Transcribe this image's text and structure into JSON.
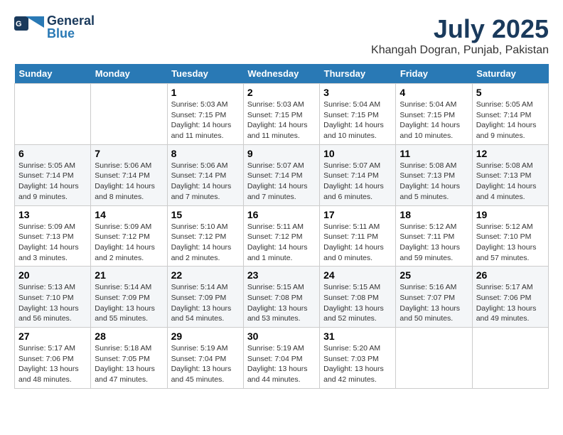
{
  "header": {
    "logo_line1": "General",
    "logo_line2": "Blue",
    "main_title": "July 2025",
    "subtitle": "Khangah Dogran, Punjab, Pakistan"
  },
  "days_of_week": [
    "Sunday",
    "Monday",
    "Tuesday",
    "Wednesday",
    "Thursday",
    "Friday",
    "Saturday"
  ],
  "weeks": [
    [
      {
        "day": "",
        "info": ""
      },
      {
        "day": "",
        "info": ""
      },
      {
        "day": "1",
        "info": "Sunrise: 5:03 AM\nSunset: 7:15 PM\nDaylight: 14 hours\nand 11 minutes."
      },
      {
        "day": "2",
        "info": "Sunrise: 5:03 AM\nSunset: 7:15 PM\nDaylight: 14 hours\nand 11 minutes."
      },
      {
        "day": "3",
        "info": "Sunrise: 5:04 AM\nSunset: 7:15 PM\nDaylight: 14 hours\nand 10 minutes."
      },
      {
        "day": "4",
        "info": "Sunrise: 5:04 AM\nSunset: 7:15 PM\nDaylight: 14 hours\nand 10 minutes."
      },
      {
        "day": "5",
        "info": "Sunrise: 5:05 AM\nSunset: 7:14 PM\nDaylight: 14 hours\nand 9 minutes."
      }
    ],
    [
      {
        "day": "6",
        "info": "Sunrise: 5:05 AM\nSunset: 7:14 PM\nDaylight: 14 hours\nand 9 minutes."
      },
      {
        "day": "7",
        "info": "Sunrise: 5:06 AM\nSunset: 7:14 PM\nDaylight: 14 hours\nand 8 minutes."
      },
      {
        "day": "8",
        "info": "Sunrise: 5:06 AM\nSunset: 7:14 PM\nDaylight: 14 hours\nand 7 minutes."
      },
      {
        "day": "9",
        "info": "Sunrise: 5:07 AM\nSunset: 7:14 PM\nDaylight: 14 hours\nand 7 minutes."
      },
      {
        "day": "10",
        "info": "Sunrise: 5:07 AM\nSunset: 7:14 PM\nDaylight: 14 hours\nand 6 minutes."
      },
      {
        "day": "11",
        "info": "Sunrise: 5:08 AM\nSunset: 7:13 PM\nDaylight: 14 hours\nand 5 minutes."
      },
      {
        "day": "12",
        "info": "Sunrise: 5:08 AM\nSunset: 7:13 PM\nDaylight: 14 hours\nand 4 minutes."
      }
    ],
    [
      {
        "day": "13",
        "info": "Sunrise: 5:09 AM\nSunset: 7:13 PM\nDaylight: 14 hours\nand 3 minutes."
      },
      {
        "day": "14",
        "info": "Sunrise: 5:09 AM\nSunset: 7:12 PM\nDaylight: 14 hours\nand 2 minutes."
      },
      {
        "day": "15",
        "info": "Sunrise: 5:10 AM\nSunset: 7:12 PM\nDaylight: 14 hours\nand 2 minutes."
      },
      {
        "day": "16",
        "info": "Sunrise: 5:11 AM\nSunset: 7:12 PM\nDaylight: 14 hours\nand 1 minute."
      },
      {
        "day": "17",
        "info": "Sunrise: 5:11 AM\nSunset: 7:11 PM\nDaylight: 14 hours\nand 0 minutes."
      },
      {
        "day": "18",
        "info": "Sunrise: 5:12 AM\nSunset: 7:11 PM\nDaylight: 13 hours\nand 59 minutes."
      },
      {
        "day": "19",
        "info": "Sunrise: 5:12 AM\nSunset: 7:10 PM\nDaylight: 13 hours\nand 57 minutes."
      }
    ],
    [
      {
        "day": "20",
        "info": "Sunrise: 5:13 AM\nSunset: 7:10 PM\nDaylight: 13 hours\nand 56 minutes."
      },
      {
        "day": "21",
        "info": "Sunrise: 5:14 AM\nSunset: 7:09 PM\nDaylight: 13 hours\nand 55 minutes."
      },
      {
        "day": "22",
        "info": "Sunrise: 5:14 AM\nSunset: 7:09 PM\nDaylight: 13 hours\nand 54 minutes."
      },
      {
        "day": "23",
        "info": "Sunrise: 5:15 AM\nSunset: 7:08 PM\nDaylight: 13 hours\nand 53 minutes."
      },
      {
        "day": "24",
        "info": "Sunrise: 5:15 AM\nSunset: 7:08 PM\nDaylight: 13 hours\nand 52 minutes."
      },
      {
        "day": "25",
        "info": "Sunrise: 5:16 AM\nSunset: 7:07 PM\nDaylight: 13 hours\nand 50 minutes."
      },
      {
        "day": "26",
        "info": "Sunrise: 5:17 AM\nSunset: 7:06 PM\nDaylight: 13 hours\nand 49 minutes."
      }
    ],
    [
      {
        "day": "27",
        "info": "Sunrise: 5:17 AM\nSunset: 7:06 PM\nDaylight: 13 hours\nand 48 minutes."
      },
      {
        "day": "28",
        "info": "Sunrise: 5:18 AM\nSunset: 7:05 PM\nDaylight: 13 hours\nand 47 minutes."
      },
      {
        "day": "29",
        "info": "Sunrise: 5:19 AM\nSunset: 7:04 PM\nDaylight: 13 hours\nand 45 minutes."
      },
      {
        "day": "30",
        "info": "Sunrise: 5:19 AM\nSunset: 7:04 PM\nDaylight: 13 hours\nand 44 minutes."
      },
      {
        "day": "31",
        "info": "Sunrise: 5:20 AM\nSunset: 7:03 PM\nDaylight: 13 hours\nand 42 minutes."
      },
      {
        "day": "",
        "info": ""
      },
      {
        "day": "",
        "info": ""
      }
    ]
  ]
}
